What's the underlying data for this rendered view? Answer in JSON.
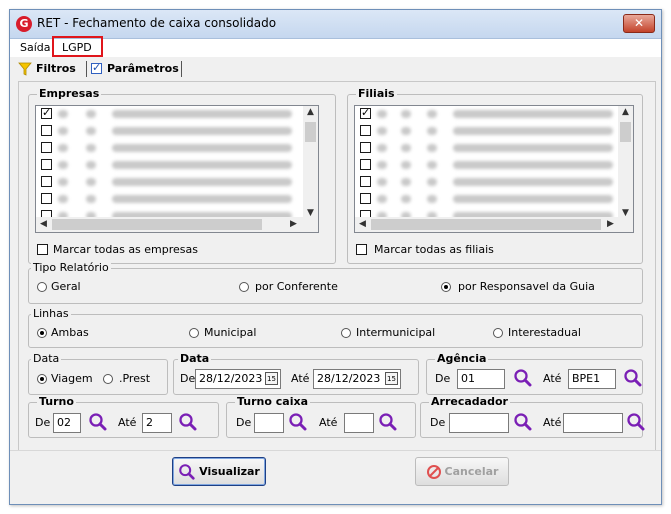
{
  "window": {
    "title": "RET - Fechamento de caixa consolidado",
    "icon_letter": "G",
    "close_glyph": "✕"
  },
  "menu": {
    "items": [
      "Saída",
      "LGPD"
    ]
  },
  "tabs": {
    "filtros": "Filtros",
    "parametros": "Parâmetros"
  },
  "empresas": {
    "title": "Empresas",
    "select_all": "Marcar todas as empresas",
    "rows": [
      true,
      false,
      false,
      false,
      false,
      false,
      false
    ]
  },
  "filiais": {
    "title": "Filiais",
    "select_all": "Marcar todas as filiais",
    "rows": [
      true,
      false,
      false,
      false,
      false,
      false,
      false
    ]
  },
  "tipo_relatorio": {
    "title": "Tipo Relatório",
    "options": [
      "Geral",
      "por Conferente",
      "por Responsavel da Guia"
    ],
    "selected": "por Responsavel da Guia"
  },
  "linhas": {
    "title": "Linhas",
    "options": [
      "Ambas",
      "Municipal",
      "Intermunicipal",
      "Interestadual"
    ],
    "selected": "Ambas"
  },
  "data_tipo": {
    "title": "Data",
    "options": [
      "Viagem",
      ".Prest"
    ],
    "selected": "Viagem"
  },
  "data": {
    "title": "Data",
    "de_label": "De",
    "ate_label": "Até",
    "de_value": "28/12/2023",
    "ate_value": "28/12/2023",
    "cal_glyph": "15"
  },
  "agencia": {
    "title": "Agência",
    "de_label": "De",
    "ate_label": "Até",
    "de_value": "01",
    "ate_value": "BPE1"
  },
  "turno": {
    "title": "Turno",
    "de_label": "De",
    "ate_label": "Até",
    "de_value": "02",
    "ate_value": "2"
  },
  "turno_caixa": {
    "title": "Turno caixa",
    "de_label": "De",
    "ate_label": "Até",
    "de_value": "",
    "ate_value": ""
  },
  "arrecadador": {
    "title": "Arrecadador",
    "de_label": "De",
    "ate_label": "Até",
    "de_value": "",
    "ate_value": ""
  },
  "buttons": {
    "visualizar": "Visualizar",
    "cancelar": "Cancelar"
  },
  "colors": {
    "accent": "#7a1fb5",
    "close": "#c3432b",
    "highlight": "#e0151b"
  }
}
